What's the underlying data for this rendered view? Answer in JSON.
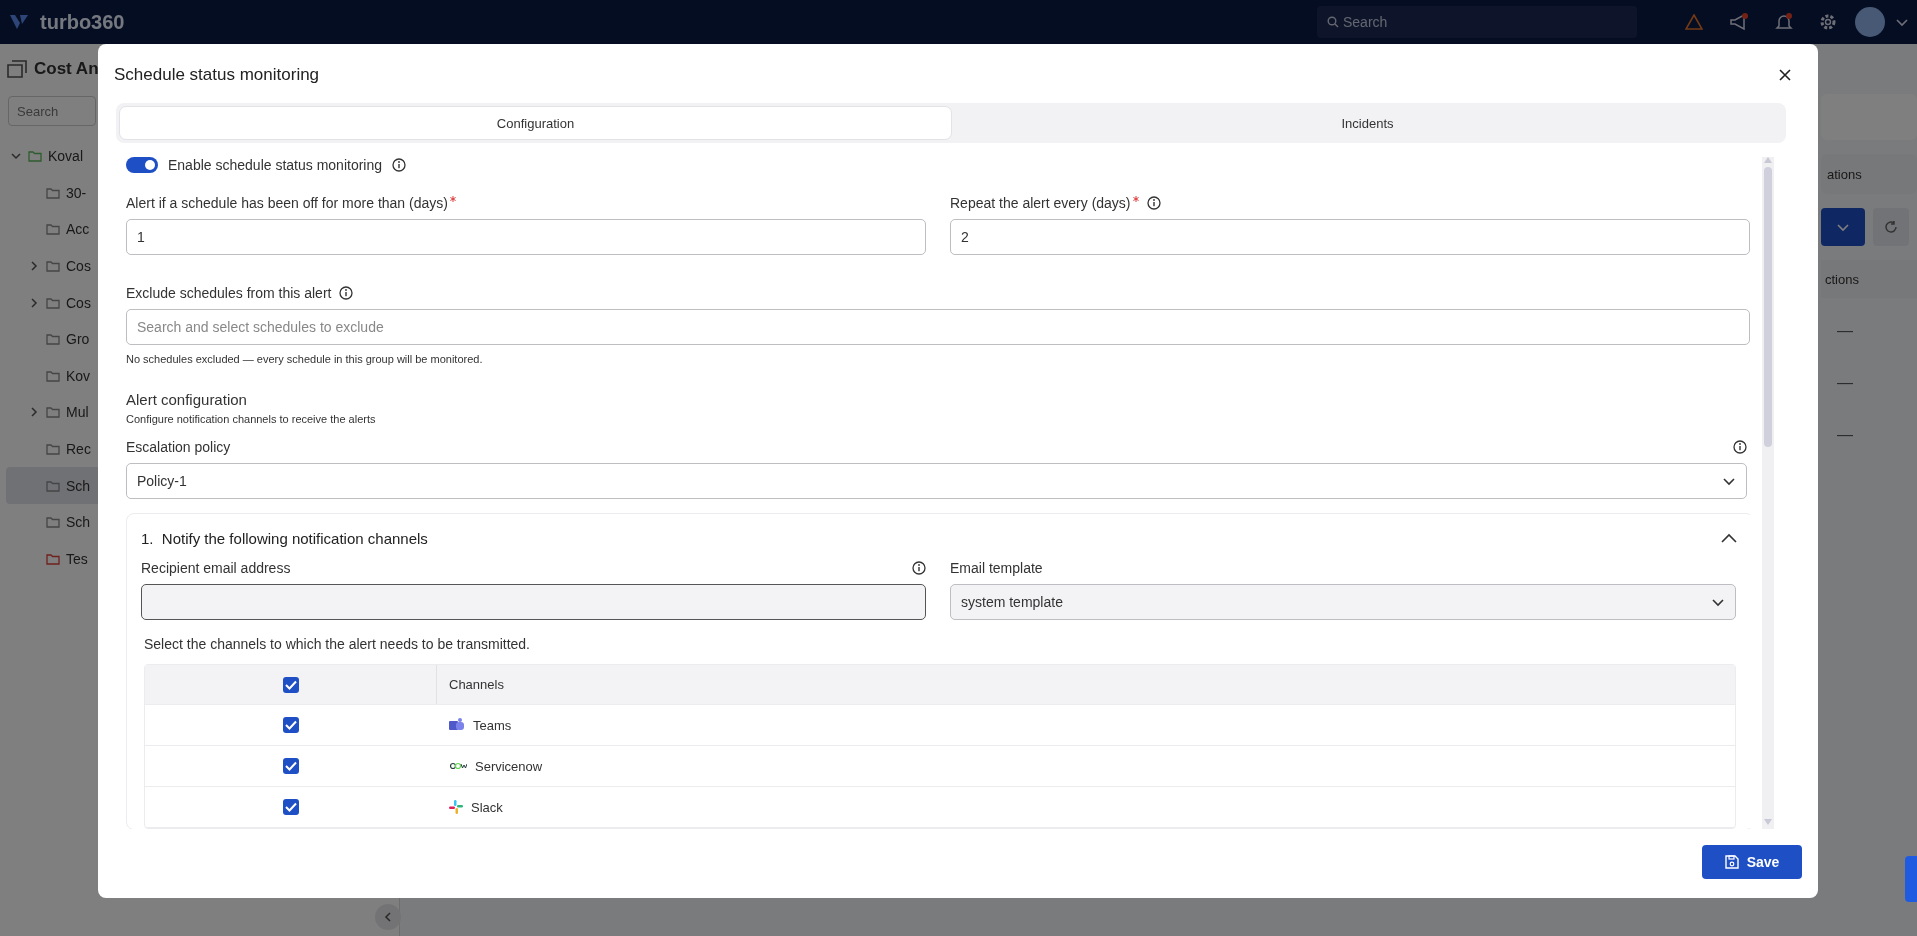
{
  "app": {
    "logo": "turbo360",
    "search": {
      "placeholder": "Search"
    },
    "sidebar": {
      "title": "Cost An",
      "search": {
        "placeholder": "Search"
      },
      "tree": [
        {
          "label": "Koval",
          "kind": "root",
          "expanded": true,
          "selected": false,
          "children": [
            {
              "label": "30-",
              "kind": "folder",
              "selected": false
            },
            {
              "label": "Acc",
              "kind": "folder",
              "selected": false
            },
            {
              "label": "Cos",
              "kind": "folder",
              "selected": false,
              "expanded": false
            },
            {
              "label": "Cos",
              "kind": "folder",
              "selected": false,
              "expanded": false
            },
            {
              "label": "Gro",
              "kind": "folder",
              "selected": false
            },
            {
              "label": "Kov",
              "kind": "folder",
              "selected": false
            },
            {
              "label": "Mul",
              "kind": "folder",
              "selected": false,
              "expanded": false
            },
            {
              "label": "Rec",
              "kind": "folder",
              "selected": false
            },
            {
              "label": "Sch",
              "kind": "folder",
              "selected": true
            },
            {
              "label": "Sch",
              "kind": "folder",
              "selected": false
            },
            {
              "label": "Tes",
              "kind": "test",
              "selected": false
            }
          ]
        }
      ]
    },
    "right_panel": {
      "button": "ations",
      "column": "ctions",
      "cells": [
        "—",
        "—",
        "—"
      ]
    }
  },
  "dialog": {
    "title": "Schedule status monitoring",
    "tabs": [
      {
        "label": "Configuration",
        "selected": true
      },
      {
        "label": "Incidents",
        "selected": false
      }
    ],
    "enable_toggle": {
      "label": "Enable schedule status monitoring",
      "on": true
    },
    "off_days": {
      "label": "Alert if a schedule has been off for more than (days)",
      "required": true,
      "value": "1"
    },
    "repeat": {
      "label": "Repeat the alert every (days)",
      "required": true,
      "value": "2"
    },
    "exclude": {
      "label": "Exclude schedules from this alert",
      "placeholder": "Search and select schedules to exclude",
      "hint": "No schedules excluded — every schedule in this group will be monitored."
    },
    "alert_configuration": {
      "title": "Alert configuration",
      "subtitle": "Configure notification channels to receive the alerts"
    },
    "escalation_policy": {
      "label": "Escalation policy",
      "value": "Policy-1"
    },
    "step": {
      "number": "1.",
      "title": "Notify the following notification channels",
      "expanded": true,
      "recipient_email": {
        "label": "Recipient email address"
      },
      "email_template": {
        "label": "Email template",
        "value": "system template"
      },
      "instruction": "Select the channels to which the alert needs to be transmitted.",
      "channels_table": {
        "all_checked": true,
        "column": "Channels",
        "rows": [
          {
            "name": "Teams",
            "kind": "teams",
            "checked": true
          },
          {
            "name": "Servicenow",
            "kind": "servicenow",
            "checked": true
          },
          {
            "name": "Slack",
            "kind": "slack",
            "checked": true
          }
        ]
      }
    },
    "save_button": "Save"
  }
}
